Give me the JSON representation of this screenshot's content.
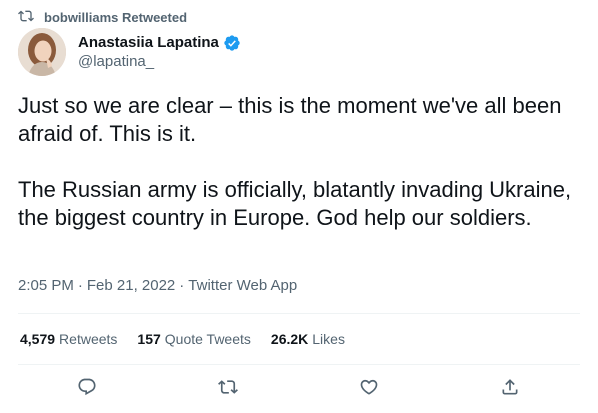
{
  "social_context": {
    "text": "bobwilliams Retweeted",
    "icon": "retweet-icon"
  },
  "author": {
    "name": "Anastasiia Lapatina",
    "handle": "@lapatina_",
    "verified": true,
    "verified_color": "#1d9bf0"
  },
  "tweet": {
    "paragraphs": [
      "Just so we are clear – this is the moment we've all been afraid of. This is it.",
      "The Russian army is officially, blatantly invading Ukraine, the biggest country in Europe. God help our soldiers."
    ]
  },
  "meta": {
    "time": "2:05 PM",
    "separator": "·",
    "date": "Feb 21, 2022",
    "source": "Twitter Web App"
  },
  "stats": {
    "retweets_count": "4,579",
    "retweets_label": "Retweets",
    "quotes_count": "157",
    "quotes_label": "Quote Tweets",
    "likes_count": "26.2K",
    "likes_label": "Likes"
  },
  "actions": [
    {
      "name": "reply",
      "icon": "reply-icon"
    },
    {
      "name": "retweet",
      "icon": "retweet-icon"
    },
    {
      "name": "like",
      "icon": "heart-icon"
    },
    {
      "name": "share",
      "icon": "share-icon"
    }
  ],
  "colors": {
    "text": "#0f1419",
    "secondary": "#536471",
    "divider": "#eff3f4",
    "verified": "#1d9bf0"
  }
}
